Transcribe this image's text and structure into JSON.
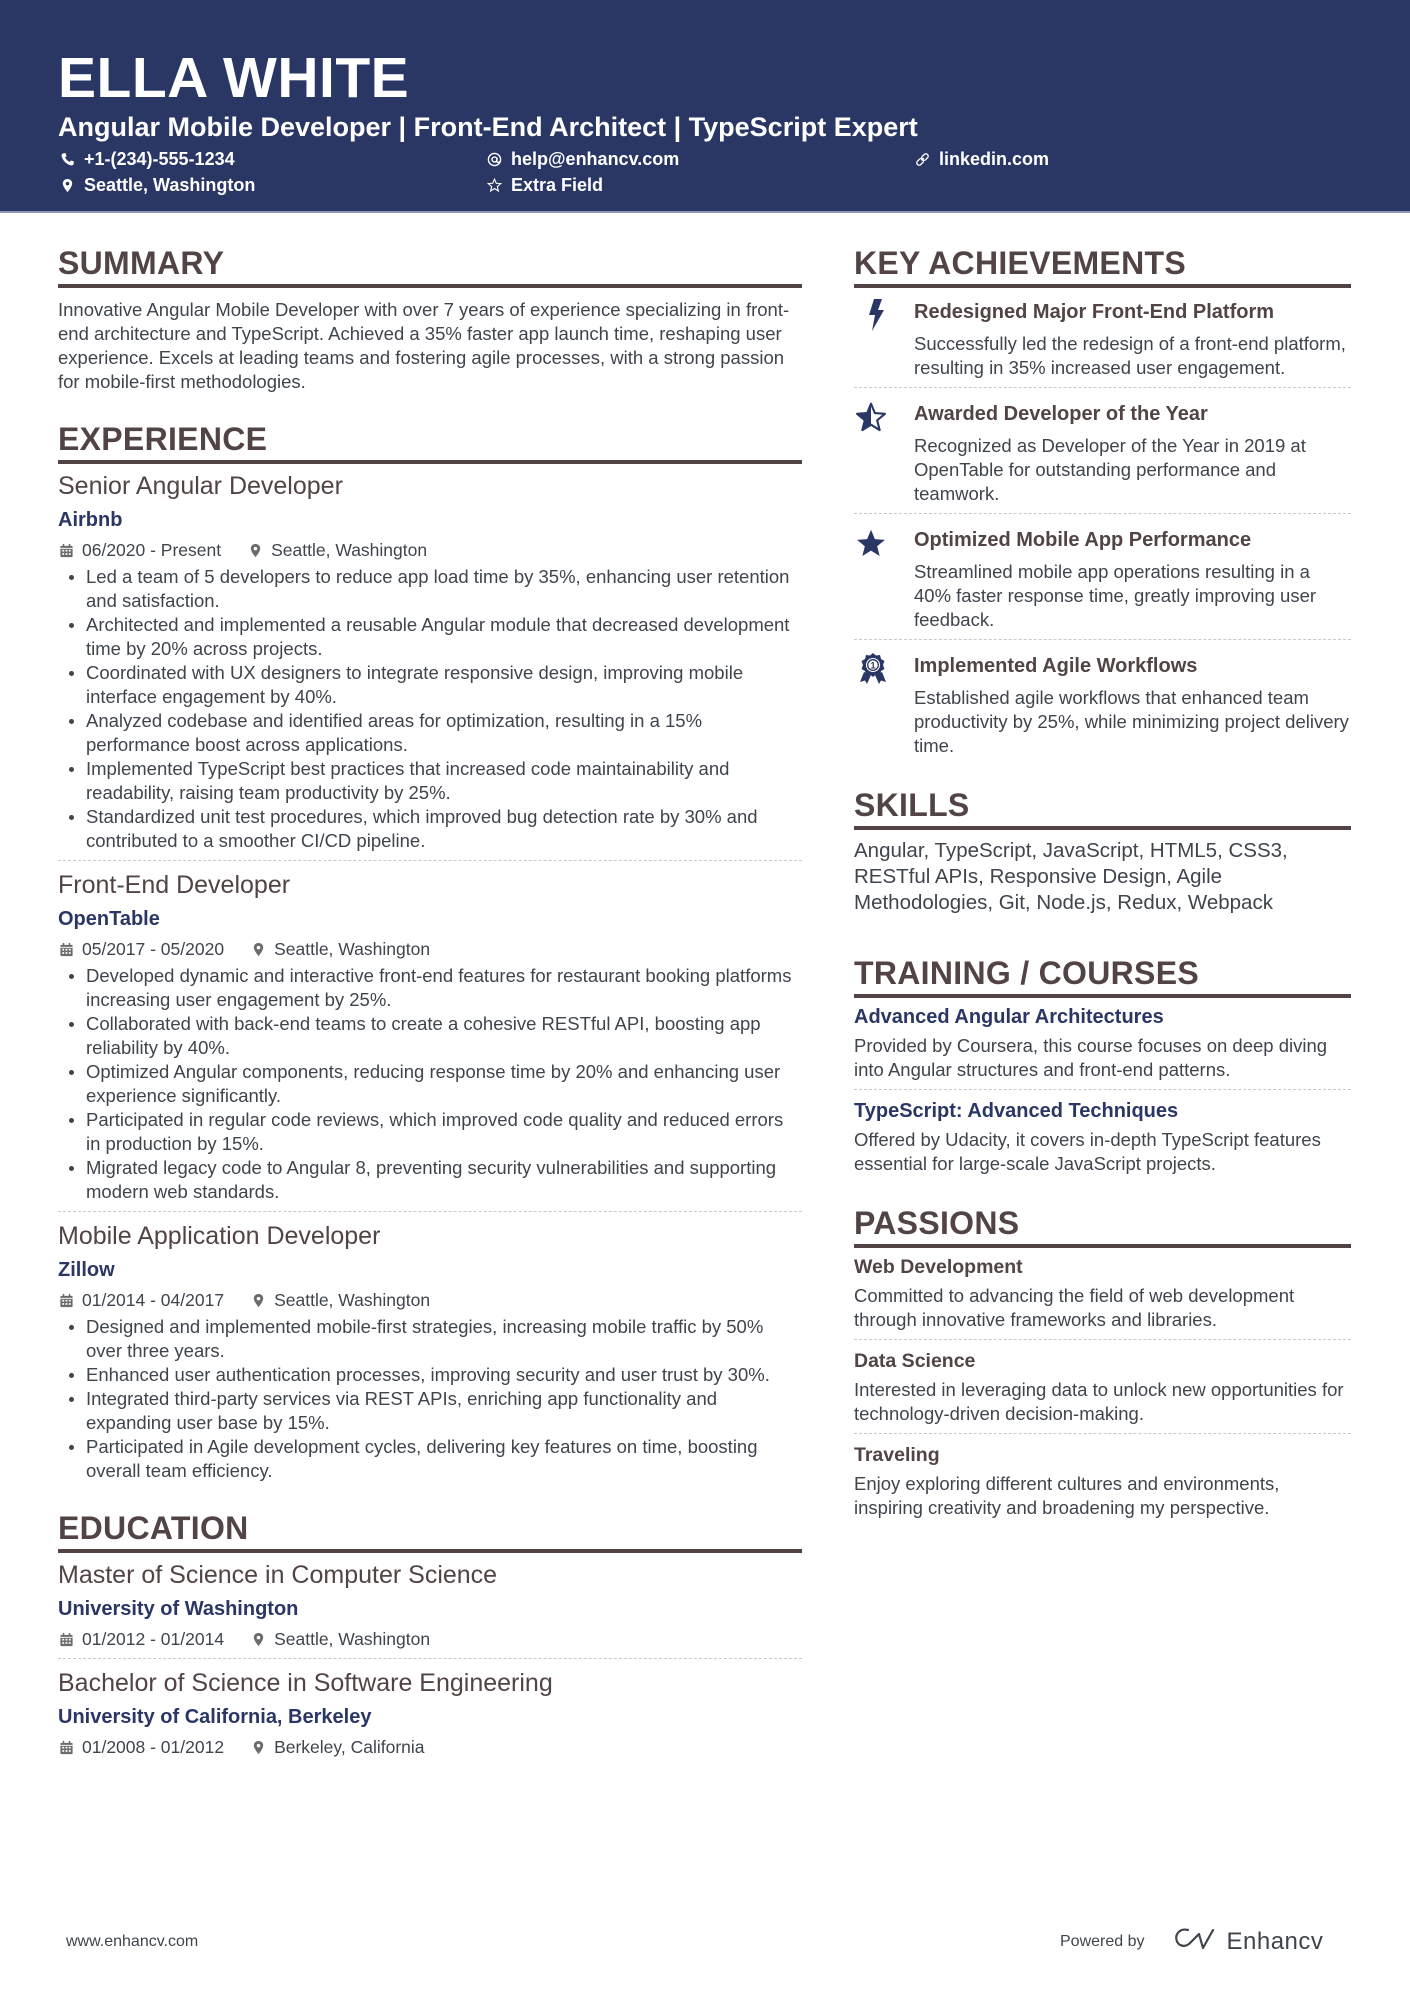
{
  "header": {
    "name": "ELLA WHITE",
    "headline": "Angular Mobile Developer | Front-End Architect | TypeScript Expert",
    "contacts": [
      {
        "icon": "phone-icon",
        "text": "+1-(234)-555-1234"
      },
      {
        "icon": "at-icon",
        "text": "help@enhancv.com"
      },
      {
        "icon": "link-icon",
        "text": "linkedin.com"
      },
      {
        "icon": "location-icon",
        "text": "Seattle, Washington"
      },
      {
        "icon": "star-outline-icon",
        "text": "Extra Field"
      }
    ],
    "colors": {
      "background": "#2a3765",
      "text": "#ffffff"
    }
  },
  "summary": {
    "title": "SUMMARY",
    "text": "Innovative Angular Mobile Developer with over 7 years of experience specializing in front-end architecture and TypeScript. Achieved a 35% faster app launch time, reshaping user experience. Excels at leading teams and fostering agile processes, with a strong passion for mobile-first methodologies."
  },
  "experience": {
    "title": "EXPERIENCE",
    "jobs": [
      {
        "title": "Senior Angular Developer",
        "company": "Airbnb",
        "dates": "06/2020 - Present",
        "location": "Seattle, Washington",
        "bullets": [
          "Led a team of 5 developers to reduce app load time by 35%, enhancing user retention and satisfaction.",
          "Architected and implemented a reusable Angular module that decreased development time by 20% across projects.",
          "Coordinated with UX designers to integrate responsive design, improving mobile interface engagement by 40%.",
          "Analyzed codebase and identified areas for optimization, resulting in a 15% performance boost across applications.",
          "Implemented TypeScript best practices that increased code maintainability and readability, raising team productivity by 25%.",
          "Standardized unit test procedures, which improved bug detection rate by 30% and contributed to a smoother CI/CD pipeline."
        ]
      },
      {
        "title": "Front-End Developer",
        "company": "OpenTable",
        "dates": "05/2017 - 05/2020",
        "location": "Seattle, Washington",
        "bullets": [
          "Developed dynamic and interactive front-end features for restaurant booking platforms increasing user engagement by 25%.",
          "Collaborated with back-end teams to create a cohesive RESTful API, boosting app reliability by 40%.",
          "Optimized Angular components, reducing response time by 20% and enhancing user experience significantly.",
          "Participated in regular code reviews, which improved code quality and reduced errors in production by 15%.",
          "Migrated legacy code to Angular 8, preventing security vulnerabilities and supporting modern web standards."
        ]
      },
      {
        "title": "Mobile Application Developer",
        "company": "Zillow",
        "dates": "01/2014 - 04/2017",
        "location": "Seattle, Washington",
        "bullets": [
          "Designed and implemented mobile-first strategies, increasing mobile traffic by 50% over three years.",
          "Enhanced user authentication processes, improving security and user trust by 30%.",
          "Integrated third-party services via REST APIs, enriching app functionality and expanding user base by 15%.",
          "Participated in Agile development cycles, delivering key features on time, boosting overall team efficiency."
        ]
      }
    ]
  },
  "education": {
    "title": "EDUCATION",
    "items": [
      {
        "degree": "Master of Science in Computer Science",
        "school": "University of Washington",
        "dates": "01/2012 - 01/2014",
        "location": "Seattle, Washington"
      },
      {
        "degree": "Bachelor of Science in Software Engineering",
        "school": "University of California, Berkeley",
        "dates": "01/2008 - 01/2012",
        "location": "Berkeley, California"
      }
    ]
  },
  "achievements": {
    "title": "KEY ACHIEVEMENTS",
    "items": [
      {
        "icon": "lightning-bolt-icon",
        "title": "Redesigned Major Front-End Platform",
        "desc": "Successfully led the redesign of a front-end platform, resulting in 35% increased user engagement."
      },
      {
        "icon": "half-star-icon",
        "title": "Awarded Developer of the Year",
        "desc": "Recognized as Developer of the Year in 2019 at OpenTable for outstanding performance and teamwork."
      },
      {
        "icon": "star-icon",
        "title": "Optimized Mobile App Performance",
        "desc": "Streamlined mobile app operations resulting in a 40% faster response time, greatly improving user feedback."
      },
      {
        "icon": "award-ribbon-icon",
        "title": "Implemented Agile Workflows",
        "desc": "Established agile workflows that enhanced team productivity by 25%, while minimizing project delivery time."
      }
    ]
  },
  "skills": {
    "title": "SKILLS",
    "text": "Angular, TypeScript, JavaScript, HTML5, CSS3, RESTful APIs, Responsive Design, Agile Methodologies, Git, Node.js, Redux, Webpack"
  },
  "training": {
    "title": "TRAINING / COURSES",
    "items": [
      {
        "title": "Advanced Angular Architectures",
        "desc": "Provided by Coursera, this course focuses on deep diving into Angular structures and front-end patterns."
      },
      {
        "title": "TypeScript: Advanced Techniques",
        "desc": "Offered by Udacity, it covers in-depth TypeScript features essential for large-scale JavaScript projects."
      }
    ]
  },
  "passions": {
    "title": "PASSIONS",
    "items": [
      {
        "title": "Web Development",
        "desc": "Committed to advancing the field of web development through innovative frameworks and libraries."
      },
      {
        "title": "Data Science",
        "desc": "Interested in leveraging data to unlock new opportunities for technology-driven decision-making."
      },
      {
        "title": "Traveling",
        "desc": "Enjoy exploring different cultures and environments, inspiring creativity and broadening my perspective."
      }
    ]
  },
  "footer": {
    "website": "www.enhancv.com",
    "powered_by": "Powered by",
    "brand": "Enhancv"
  },
  "theme": {
    "accent": "#2a3765",
    "heading": "#524445",
    "body": "#3f454d"
  }
}
